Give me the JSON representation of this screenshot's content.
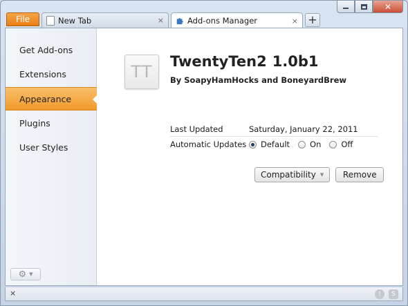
{
  "browser": {
    "file_menu_label": "File",
    "tabs": [
      {
        "title": "New Tab",
        "close_glyph": "×",
        "icon": "page-icon"
      },
      {
        "title": "Add-ons Manager",
        "close_glyph": "×",
        "icon": "puzzle-icon"
      }
    ],
    "new_tab_glyph": "+"
  },
  "sidebar": {
    "items": [
      {
        "label": "Get Add-ons"
      },
      {
        "label": "Extensions"
      },
      {
        "label": "Appearance",
        "selected": true
      },
      {
        "label": "Plugins"
      },
      {
        "label": "User Styles"
      }
    ],
    "tools_icon": "gear-icon"
  },
  "addon": {
    "icon_text": "TT",
    "name": "TwentyTen2",
    "version": "1.0b1",
    "author_line": "By SoapyHamHocks and BoneyardBrew",
    "details": {
      "last_updated_label": "Last Updated",
      "last_updated_value": "Saturday, January 22, 2011",
      "auto_updates_label": "Automatic Updates",
      "auto_updates_options": [
        "Default",
        "On",
        "Off"
      ],
      "auto_updates_selected": "Default"
    },
    "buttons": {
      "compatibility": "Compatibility",
      "remove": "Remove"
    }
  },
  "statusbar": {
    "close_glyph": "×"
  },
  "colors": {
    "accent": "#f19a2a",
    "file_button": "#e77f12"
  }
}
